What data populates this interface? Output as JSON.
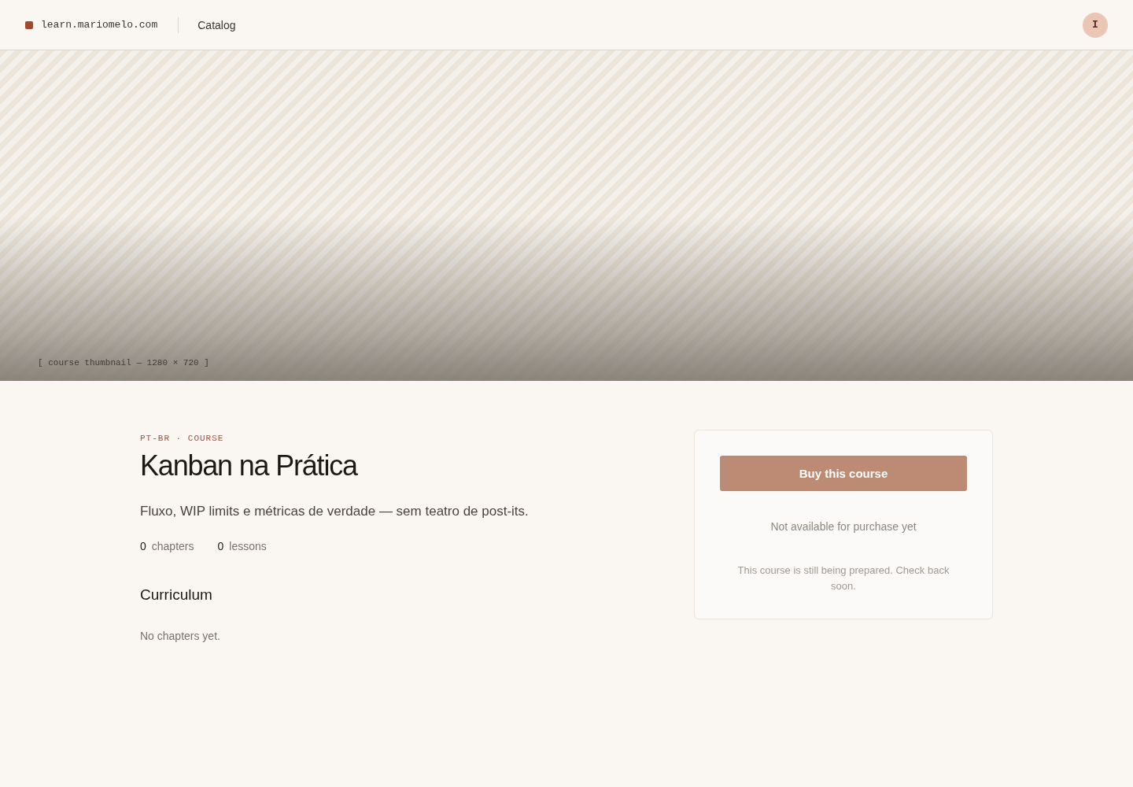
{
  "header": {
    "site": "learn.mariomelo.com",
    "nav": [
      {
        "label": "Catalog",
        "selected": false
      }
    ],
    "avatar_initial": "I"
  },
  "hero": {
    "caption": "[ course thumbnail — 1280 × 720 ]"
  },
  "course": {
    "eyebrow": "PT-BR · COURSE",
    "title": "Kanban na Prática",
    "subtitle": "Fluxo, WIP limits e métricas de verdade — sem teatro de post-its.",
    "stats": [
      {
        "value": "0",
        "label": "chapters"
      },
      {
        "value": "0",
        "label": "lessons"
      }
    ]
  },
  "curriculum": {
    "heading": "Curriculum",
    "empty_message": "No chapters yet."
  },
  "purchase": {
    "button": {
      "label": "Buy this course",
      "disabled": true
    },
    "status": "Not available for purchase yet",
    "note": "This course is still being prepared. Check back soon."
  }
}
